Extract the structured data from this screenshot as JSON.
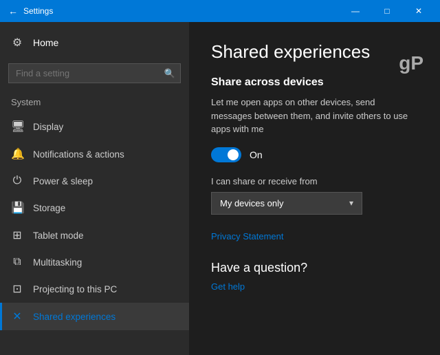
{
  "titlebar": {
    "back_icon": "←",
    "title": "Settings",
    "minimize": "—",
    "maximize": "□",
    "close": "✕"
  },
  "sidebar": {
    "search_placeholder": "Find a setting",
    "search_icon": "🔍",
    "home_label": "Home",
    "home_icon": "⚙",
    "section_label": "System",
    "nav_items": [
      {
        "id": "display",
        "label": "Display",
        "icon": "🖥"
      },
      {
        "id": "notifications",
        "label": "Notifications & actions",
        "icon": "🔔"
      },
      {
        "id": "power",
        "label": "Power & sleep",
        "icon": "⏻"
      },
      {
        "id": "storage",
        "label": "Storage",
        "icon": "💾"
      },
      {
        "id": "tablet",
        "label": "Tablet mode",
        "icon": "⊞"
      },
      {
        "id": "multitasking",
        "label": "Multitasking",
        "icon": "⧉"
      },
      {
        "id": "projecting",
        "label": "Projecting to this PC",
        "icon": "⊡"
      },
      {
        "id": "shared",
        "label": "Shared experiences",
        "icon": "✕",
        "active": true
      }
    ]
  },
  "content": {
    "gp_logo": "gP",
    "page_title": "Shared experiences",
    "share_section_title": "Share across devices",
    "description": "Let me open apps on other devices, send messages between them, and invite others to use apps with me",
    "toggle_state": "On",
    "share_from_label": "I can share or receive from",
    "dropdown_value": "My devices only",
    "dropdown_arrow": "▾",
    "privacy_link": "Privacy Statement",
    "question_title": "Have a question?",
    "help_link": "Get help"
  }
}
